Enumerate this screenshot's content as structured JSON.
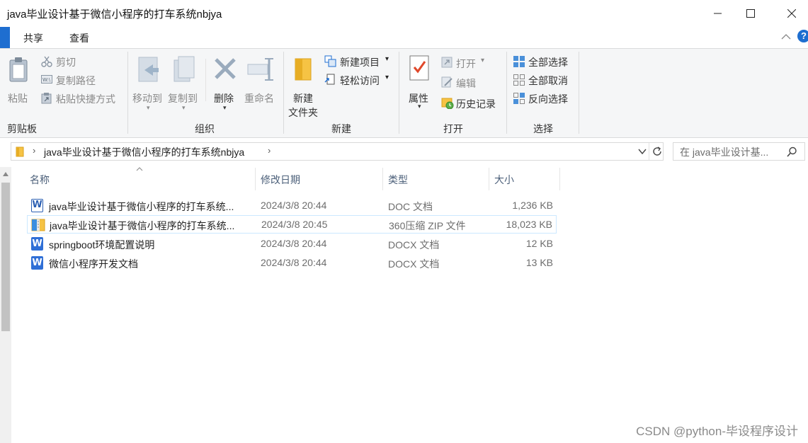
{
  "window": {
    "title": "java毕业设计基于微信小程序的打车系统nbjya"
  },
  "menu": {
    "tabs": [
      "共享",
      "查看"
    ]
  },
  "ribbon": {
    "clipboard": {
      "paste": "粘贴",
      "cut": "剪切",
      "copy_path": "复制路径",
      "paste_shortcut": "粘贴快捷方式",
      "group": "剪贴板"
    },
    "organize": {
      "move_to": "移动到",
      "copy_to": "复制到",
      "delete": "删除",
      "rename": "重命名",
      "group": "组织"
    },
    "new": {
      "new_folder_line1": "新建",
      "new_folder_line2": "文件夹",
      "new_item": "新建项目",
      "easy_access": "轻松访问",
      "group": "新建"
    },
    "open": {
      "properties": "属性",
      "open": "打开",
      "edit": "编辑",
      "history": "历史记录",
      "group": "打开"
    },
    "select": {
      "select_all": "全部选择",
      "select_none": "全部取消",
      "invert": "反向选择",
      "group": "选择"
    }
  },
  "address": {
    "path": "java毕业设计基于微信小程序的打车系统nbjya",
    "search_placeholder": "在 java毕业设计基..."
  },
  "columns": {
    "name": "名称",
    "date": "修改日期",
    "type": "类型",
    "size": "大小"
  },
  "files": [
    {
      "name": "java毕业设计基于微信小程序的打车系统...",
      "date": "2024/3/8 20:44",
      "type": "DOC 文档",
      "size": "1,236 KB",
      "icon": "doc"
    },
    {
      "name": "java毕业设计基于微信小程序的打车系统...",
      "date": "2024/3/8 20:45",
      "type": "360压缩 ZIP 文件",
      "size": "18,023 KB",
      "icon": "zip"
    },
    {
      "name": "springboot环境配置说明",
      "date": "2024/3/8 20:44",
      "type": "DOCX 文档",
      "size": "12 KB",
      "icon": "docx"
    },
    {
      "name": "微信小程序开发文档",
      "date": "2024/3/8 20:44",
      "type": "DOCX 文档",
      "size": "13 KB",
      "icon": "docx"
    }
  ],
  "watermark": "CSDN @python-毕设程序设计"
}
